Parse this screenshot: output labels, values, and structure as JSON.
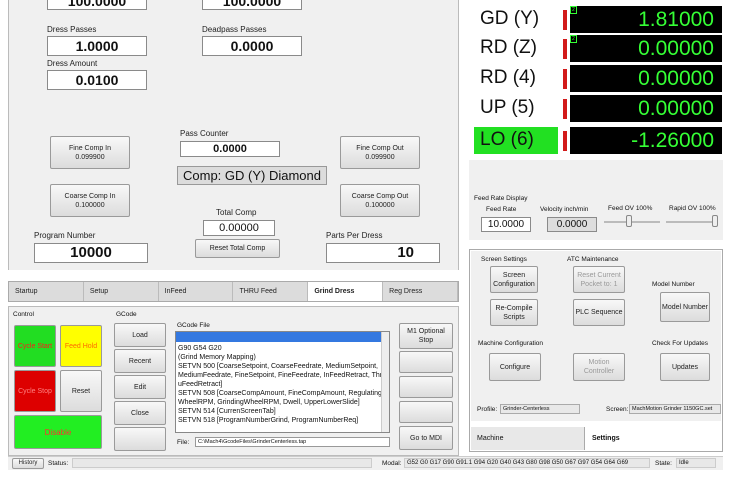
{
  "top_fields": {
    "top_left_value": "100.0000",
    "top_mid_value": "100.0000",
    "dress_passes_label": "Dress Passes",
    "dress_passes_value": "1.0000",
    "deadpass_label": "Deadpass Passes",
    "deadpass_value": "0.0000",
    "dress_amount_label": "Dress Amount",
    "dress_amount_value": "0.0100"
  },
  "comp": {
    "pass_counter_label": "Pass Counter",
    "pass_counter_value": "0.0000",
    "fine_comp_in": "Fine Comp In",
    "fine_comp_in_value": "0.099900",
    "fine_comp_out": "Fine Comp Out",
    "fine_comp_out_value": "0.099900",
    "coarse_comp_in": "Coarse Comp In",
    "coarse_comp_in_value": "0.100000",
    "coarse_comp_out": "Coarse Comp Out",
    "coarse_comp_out_value": "0.100000",
    "comp_banner": "Comp: GD (Y) Diamond",
    "total_comp_label": "Total Comp",
    "total_comp_value": "0.00000",
    "reset_total_comp": "Reset Total Comp",
    "program_number_label": "Program Number",
    "program_number_value": "10000",
    "parts_per_dress_label": "Parts Per Dress",
    "parts_per_dress_value": "10"
  },
  "dro": [
    {
      "axis": "GD (Y)",
      "value": "1.81000",
      "badge": "2"
    },
    {
      "axis": "RD (Z)",
      "value": "0.00000",
      "badge": "2"
    },
    {
      "axis": "RD (4)",
      "value": "0.00000",
      "badge": ""
    },
    {
      "axis": "UP (5)",
      "value": "0.00000",
      "badge": ""
    },
    {
      "axis": "LO (6)",
      "value": "-1.26000",
      "badge": ""
    }
  ],
  "feed": {
    "title": "Feed Rate Display",
    "feed_rate_label": "Feed Rate",
    "feed_rate_value": "10.0000",
    "velocity_label": "Velocity inch/min",
    "velocity_value": "0.0000",
    "feed_ov_label": "Feed OV 100%",
    "rapid_ov_label": "Rapid OV 100%"
  },
  "settings": {
    "screen_settings": "Screen Settings",
    "screen_config": "Screen Configuration",
    "recompile": "Re-Compile Scripts",
    "atc_maint": "ATC Maintenance",
    "reset_pocket": "Reset Current Pocket to: 1",
    "plc_sequence": "PLC Sequence",
    "model_number_label": "Model Number",
    "model_number_btn": "Model Number",
    "machine_config_label": "Machine Configuration",
    "configure": "Configure",
    "motion_controller": "Motion Controller",
    "check_updates_label": "Check For Updates",
    "updates": "Updates",
    "profile_label": "Profile:",
    "profile_value": "Grinder-Centerless",
    "screen_label": "Screen:",
    "screen_value": "MachMotion Grinder 1150GC.set",
    "tab_machine": "Machine",
    "tab_settings": "Settings"
  },
  "tabs": [
    "Startup",
    "Setup",
    "InFeed",
    "THRU Feed",
    "Grind Dress",
    "Reg Dress"
  ],
  "active_tab": "Grind Dress",
  "control": {
    "label": "Control",
    "cycle_start": "Cycle Start",
    "feed_hold": "Feed Hold",
    "cycle_stop": "Cycle Stop",
    "reset": "Reset",
    "disable": "Disable"
  },
  "gcode": {
    "label": "GCode",
    "load": "Load",
    "recent": "Recent",
    "edit": "Edit",
    "close": "Close",
    "file_label": "GCode File",
    "lines": [
      "G90 G54 G20",
      "(Grind Memory Mapping)",
      "SETVN 500 [CoarseSetpoint, CoarseFeedrate, MediumSetpoint,",
      "MediumFeedrate, FineSetpoint, FineFeedrate, InFeedRetract, Thr",
      "uFeedRetract]",
      "SETVN 508 [CoarseCompAmount, FineCompAmount, Regulating",
      "WheelRPM, GrindingWheelRPM, Dwell, UpperLowerSlide]",
      "SETVN 514 [CurrenScreenTab]",
      "SETVN 518 [ProgramNumberGrind, ProgramNumberReq]"
    ],
    "file_path_label": "File:",
    "file_path": "C:\\Mach4\\GcodeFiles\\GrinderCenterless.tap",
    "m1_optional_stop": "M1 Optional Stop",
    "goto_mdi": "Go to MDI"
  },
  "status": {
    "history": "History",
    "status_label": "Status:",
    "modal_label": "Modal:",
    "modal_value": "G52 G0 G17 G90 G91.1 G94 G20 G40 G43 G80 G98 G50 G67 G97 G54 G64 G69",
    "state_label": "State:",
    "state_value": "Idle"
  },
  "colors": {
    "dro_green": "#35ff35",
    "cycle_start": "#22dd22",
    "feed_hold": "#ffff00",
    "cycle_stop": "#dd0000",
    "lo_highlight": "#22e022"
  }
}
